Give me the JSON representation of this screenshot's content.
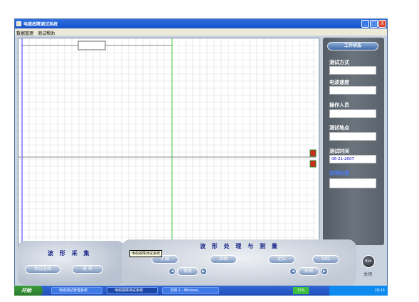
{
  "window": {
    "title": "电缆故障测试系统",
    "controls": {
      "minimize": "_",
      "maximize": "□",
      "close": "X"
    }
  },
  "menu": {
    "items": [
      "数据管理",
      "测试帮助"
    ]
  },
  "right_panel": {
    "top_button": "工作状态",
    "fields": [
      {
        "label": "测试方式",
        "value": ""
      },
      {
        "label": "电波速度",
        "value": ""
      },
      {
        "label": "操作人员",
        "value": ""
      },
      {
        "label": "测试地点",
        "value": ""
      },
      {
        "label": "测试时间",
        "value": "06-21-2007"
      },
      {
        "label": "故障距离",
        "value": ""
      }
    ]
  },
  "sampling": {
    "heading": "波 形 采 集",
    "select_button": "测试选择",
    "sample_button": "采 样"
  },
  "processing": {
    "heading": "波 形 处 理 与 测 量",
    "expand_button": "扩展",
    "compress_button": "压缩",
    "locate_button": "定位",
    "reset_button": "归位",
    "restore_button": "恢复",
    "adjust_button": "校调"
  },
  "exit": {
    "icon_label": "Exit",
    "label": "关闭"
  },
  "tooltip": "电缆故障测试系统",
  "taskbar": {
    "start": "开始",
    "tasks": [
      "电缆测试管理系统",
      "电缆故障测试系统",
      "文档 1 - Microso..."
    ],
    "zoom": "72%",
    "clock": "19:15"
  },
  "colors": {
    "titlebar": "#1650c8",
    "grid_line": "#dcdcdc",
    "cursor_line": "#4cd04c",
    "axis_line": "#888888",
    "panel_bg": "#5a626c",
    "marker": "#cc2a1a"
  }
}
